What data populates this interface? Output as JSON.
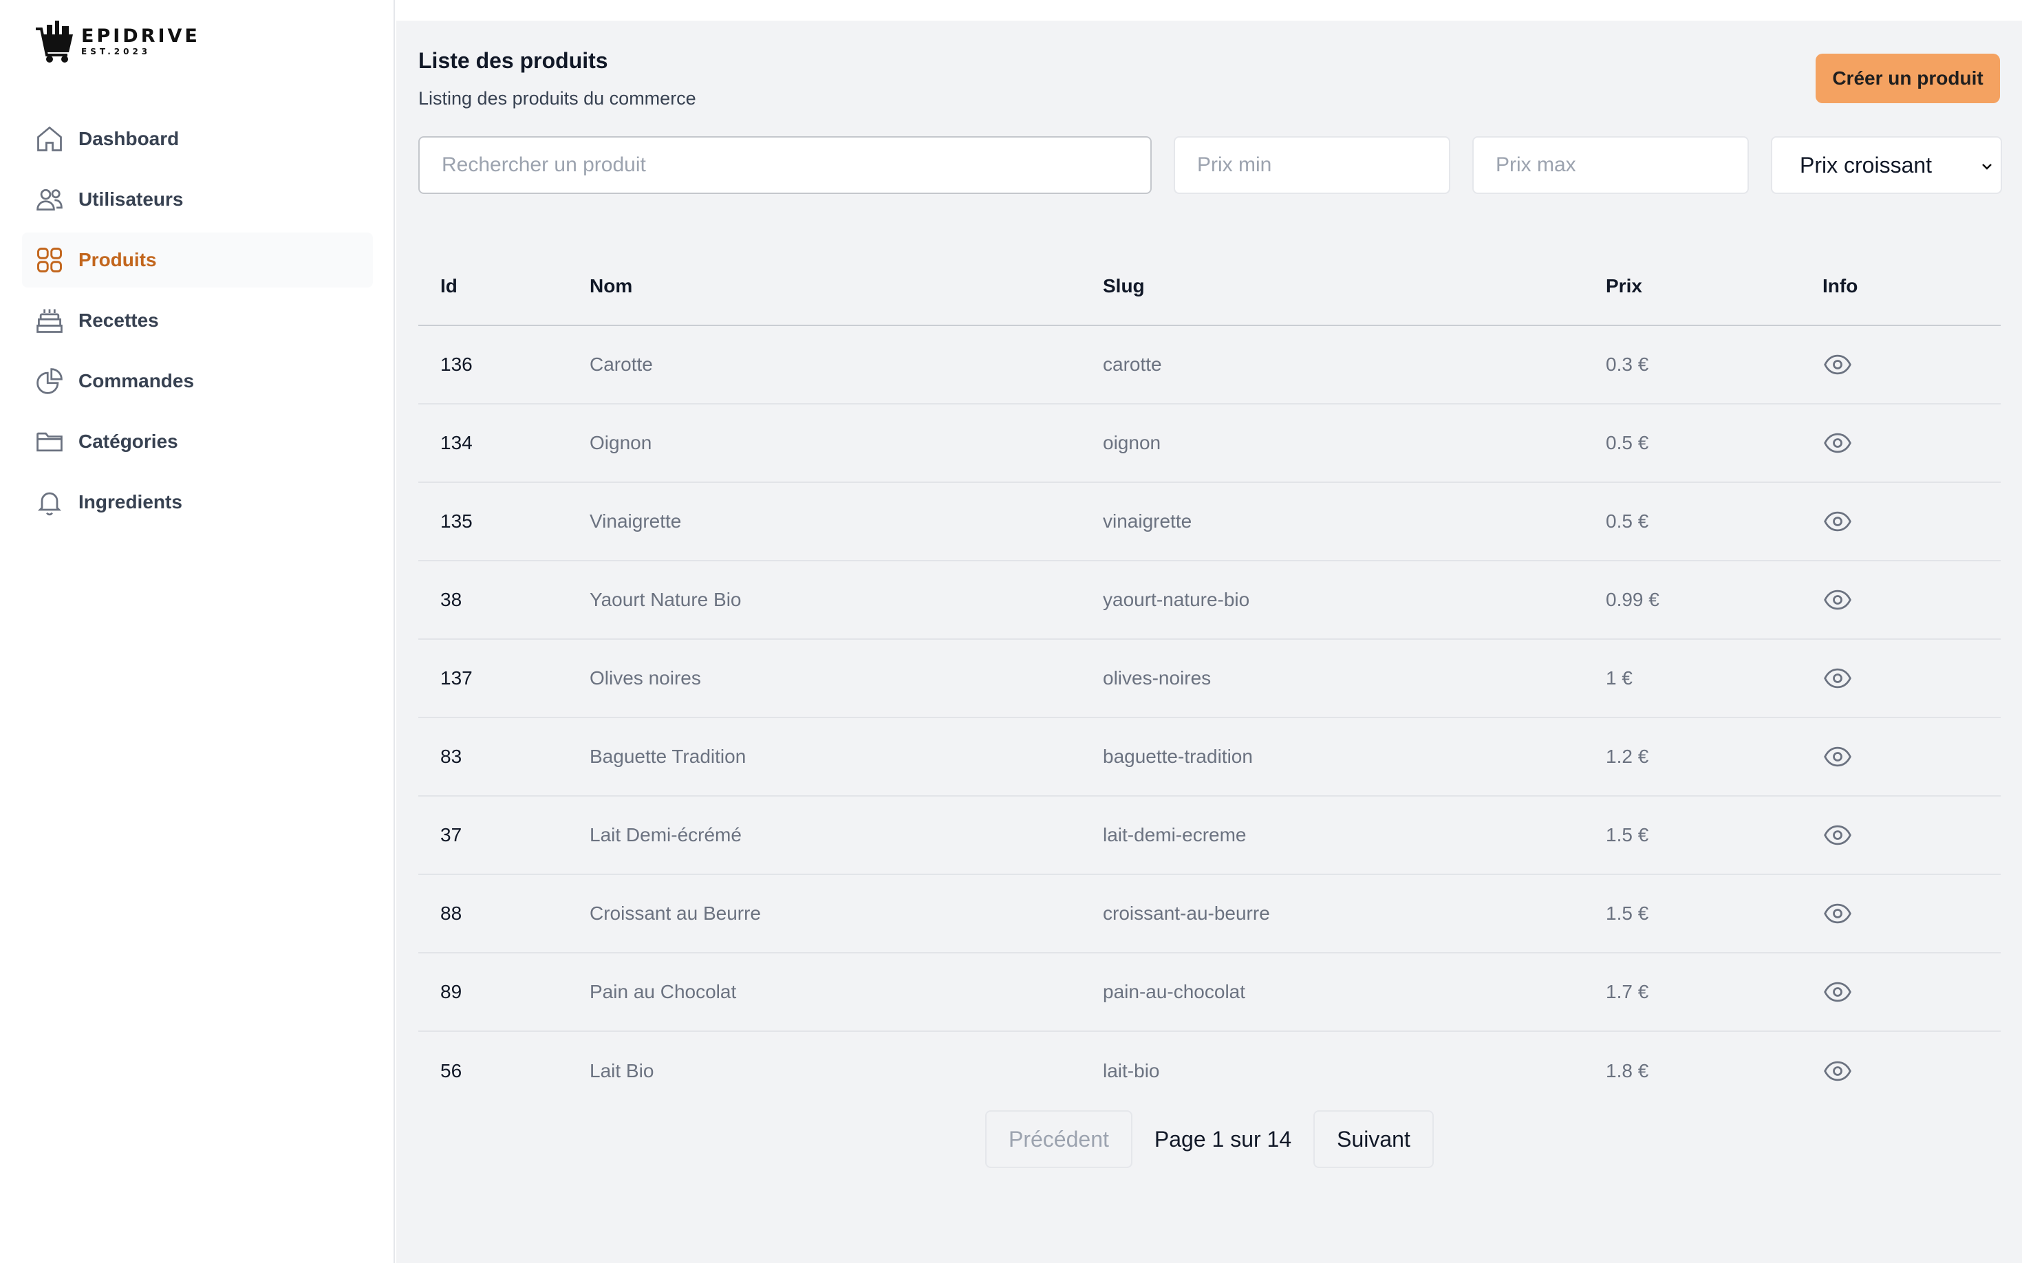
{
  "brand": {
    "name": "EPIDRIVE",
    "est": "EST.2023"
  },
  "sidebar": {
    "items": [
      {
        "label": "Dashboard",
        "icon": "home-icon",
        "active": false
      },
      {
        "label": "Utilisateurs",
        "icon": "users-icon",
        "active": false
      },
      {
        "label": "Produits",
        "icon": "grid-icon",
        "active": true
      },
      {
        "label": "Recettes",
        "icon": "cake-icon",
        "active": false
      },
      {
        "label": "Commandes",
        "icon": "pie-chart-icon",
        "active": false
      },
      {
        "label": "Catégories",
        "icon": "folder-icon",
        "active": false
      },
      {
        "label": "Ingredients",
        "icon": "bell-icon",
        "active": false
      }
    ]
  },
  "header": {
    "title": "Liste des produits",
    "subtitle": "Listing des produits du commerce",
    "create_label": "Créer un produit"
  },
  "filters": {
    "search_placeholder": "Rechercher un produit",
    "min_placeholder": "Prix min",
    "max_placeholder": "Prix max",
    "sort_value": "Prix croissant"
  },
  "table": {
    "headers": {
      "id": "Id",
      "name": "Nom",
      "slug": "Slug",
      "price": "Prix",
      "info": "Info"
    },
    "rows": [
      {
        "id": "136",
        "name": "Carotte",
        "slug": "carotte",
        "price": "0.3 €"
      },
      {
        "id": "134",
        "name": "Oignon",
        "slug": "oignon",
        "price": "0.5 €"
      },
      {
        "id": "135",
        "name": "Vinaigrette",
        "slug": "vinaigrette",
        "price": "0.5 €"
      },
      {
        "id": "38",
        "name": "Yaourt Nature Bio",
        "slug": "yaourt-nature-bio",
        "price": "0.99 €"
      },
      {
        "id": "137",
        "name": "Olives noires",
        "slug": "olives-noires",
        "price": "1 €"
      },
      {
        "id": "83",
        "name": "Baguette Tradition",
        "slug": "baguette-tradition",
        "price": "1.2 €"
      },
      {
        "id": "37",
        "name": "Lait Demi-écrémé",
        "slug": "lait-demi-ecreme",
        "price": "1.5 €"
      },
      {
        "id": "88",
        "name": "Croissant au Beurre",
        "slug": "croissant-au-beurre",
        "price": "1.5 €"
      },
      {
        "id": "89",
        "name": "Pain au Chocolat",
        "slug": "pain-au-chocolat",
        "price": "1.7 €"
      },
      {
        "id": "56",
        "name": "Lait Bio",
        "slug": "lait-bio",
        "price": "1.8 €"
      }
    ]
  },
  "pagination": {
    "prev_label": "Précédent",
    "info": "Page 1 sur 14",
    "next_label": "Suivant"
  },
  "colors": {
    "accent": "#f4a261",
    "active_nav": "#c2661d",
    "background": "#f2f3f5"
  }
}
